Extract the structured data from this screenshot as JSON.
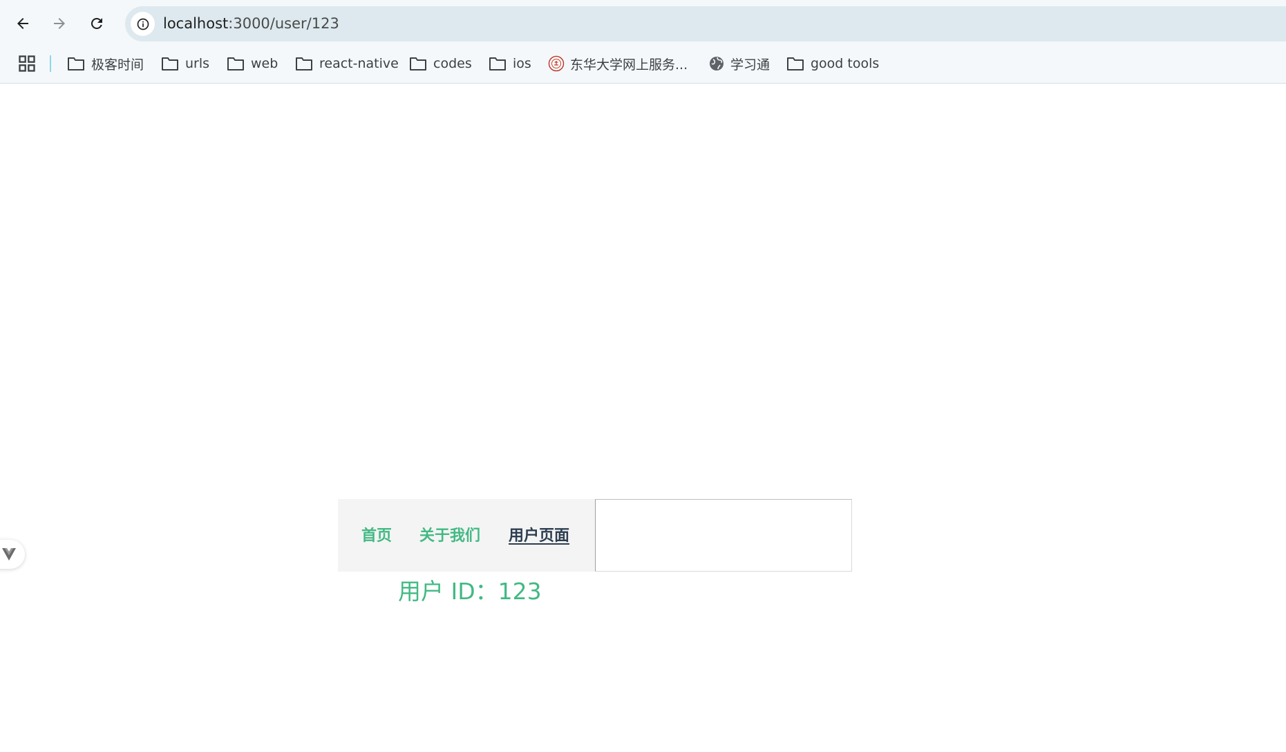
{
  "browser": {
    "url": {
      "host": "localhost",
      "path": ":3000/user/123"
    },
    "icons": {
      "back": "arrow-left-icon",
      "forward": "arrow-right-icon",
      "reload": "reload-icon",
      "site_info": "info-circle-icon",
      "apps": "apps-grid-icon"
    },
    "bookmarks": [
      {
        "label": "极客时间",
        "icon": "folder-icon"
      },
      {
        "label": "urls",
        "icon": "folder-icon"
      },
      {
        "label": "web",
        "icon": "folder-icon"
      },
      {
        "label": "react-native",
        "icon": "folder-icon"
      },
      {
        "label": "codes",
        "icon": "folder-icon"
      },
      {
        "label": "ios",
        "icon": "folder-icon"
      },
      {
        "label": "东华大学网上服务...",
        "icon": "university-seal-icon"
      },
      {
        "label": "学习通",
        "icon": "globe-icon"
      },
      {
        "label": "good tools",
        "icon": "folder-icon"
      }
    ]
  },
  "app": {
    "nav": {
      "home": "首页",
      "about": "关于我们",
      "user": "用户页面",
      "active": "user"
    },
    "user_id_text": "用户 ID：123",
    "colors": {
      "link": "#42b983",
      "active_link": "#2c3e50",
      "nav_background": "#f4f4f4"
    }
  }
}
